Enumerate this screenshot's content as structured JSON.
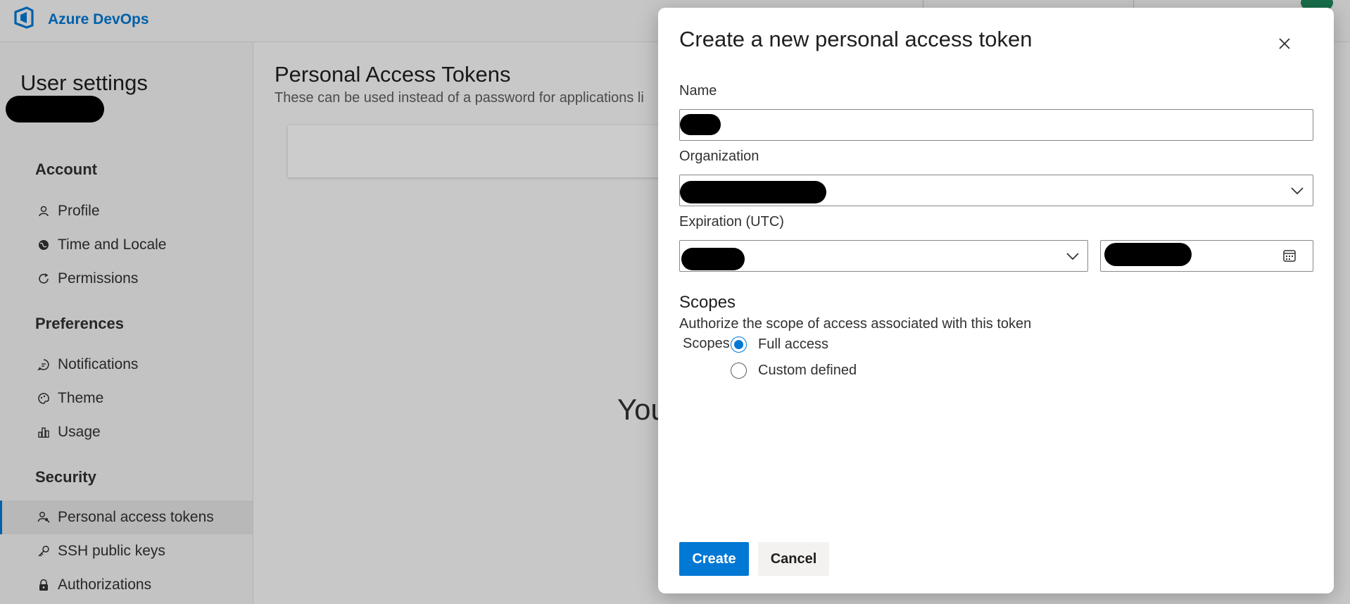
{
  "header": {
    "app_name": "Azure DevOps",
    "logo_icon": "azure-devops-logo-icon"
  },
  "sidebar": {
    "title": "User settings",
    "sections": [
      {
        "label": "Account",
        "items": [
          {
            "label": "Profile",
            "icon": "profile-icon"
          },
          {
            "label": "Time and Locale",
            "icon": "globe-icon"
          },
          {
            "label": "Permissions",
            "icon": "refresh-icon"
          }
        ]
      },
      {
        "label": "Preferences",
        "items": [
          {
            "label": "Notifications",
            "icon": "chat-icon"
          },
          {
            "label": "Theme",
            "icon": "palette-icon"
          },
          {
            "label": "Usage",
            "icon": "bar-chart-icon"
          }
        ]
      },
      {
        "label": "Security",
        "items": [
          {
            "label": "Personal access tokens",
            "icon": "person-key-icon",
            "active": true
          },
          {
            "label": "SSH public keys",
            "icon": "key-icon"
          },
          {
            "label": "Authorizations",
            "icon": "lock-icon"
          }
        ]
      }
    ]
  },
  "main": {
    "title": "Personal Access Tokens",
    "subtitle": "These can be used instead of a password for applications li",
    "empty_text": "You"
  },
  "dialog": {
    "title": "Create a new personal access token",
    "name_label": "Name",
    "organization_label": "Organization",
    "expiration_label": "Expiration (UTC)",
    "scopes_heading": "Scopes",
    "scopes_description": "Authorize the scope of access associated with this token",
    "scopes_label": "Scopes",
    "scope_options": [
      {
        "label": "Full access",
        "checked": true
      },
      {
        "label": "Custom defined",
        "checked": false
      }
    ],
    "create_label": "Create",
    "cancel_label": "Cancel"
  },
  "colors": {
    "accent": "#0078d4",
    "avatar": "#1f8a5b"
  }
}
